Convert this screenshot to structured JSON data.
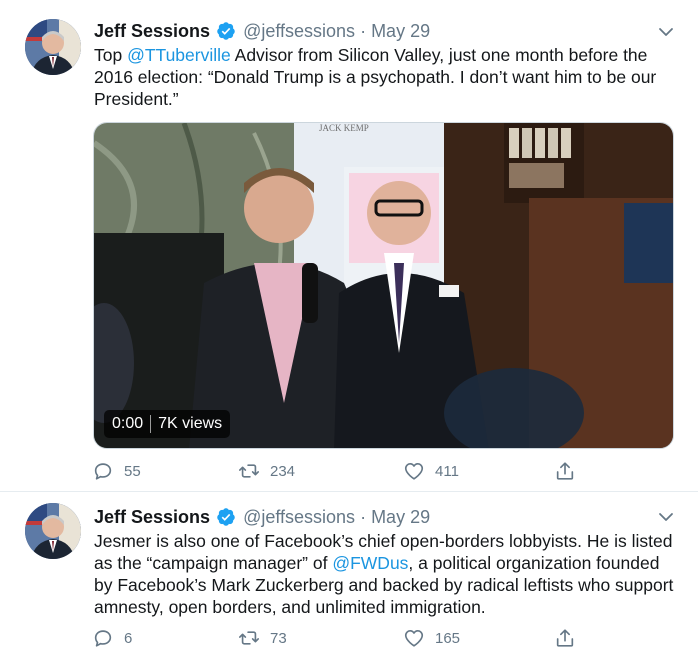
{
  "tweets": [
    {
      "display_name": "Jeff Sessions",
      "handle": "@jeffsessions",
      "separator": "·",
      "date": "May 29",
      "text_parts": {
        "before": "Top ",
        "mention": "@TTuberville",
        "after": " Advisor from Silicon Valley, just one month before the 2016 election: “Donald Trump is a psychopath. I don’t want him to be our President.”"
      },
      "video": {
        "time": "0:00",
        "views": "7K views",
        "backdrop_text": "JACK KEMP"
      },
      "counts": {
        "replies": "55",
        "retweets": "234",
        "likes": "411"
      }
    },
    {
      "display_name": "Jeff Sessions",
      "handle": "@jeffsessions",
      "separator": "·",
      "date": "May 29",
      "text_parts": {
        "before": "Jesmer is also one of Facebook’s chief open-borders lobbyists. He is listed as the “campaign manager” of ",
        "mention": "@FWDus",
        "after": ", a political organization founded by Facebook’s Mark Zuckerberg and backed by radical leftists who support amnesty, open borders, and unlimited immigration."
      },
      "counts": {
        "replies": "6",
        "retweets": "73",
        "likes": "165"
      }
    }
  ],
  "colors": {
    "link": "#1b95e0",
    "secondary_text": "#657786",
    "verified": "#1da1f2",
    "divider": "#e6ecf0"
  },
  "icons": [
    "verified-badge-icon",
    "caret-down-icon",
    "reply-icon",
    "retweet-icon",
    "like-icon",
    "share-icon"
  ]
}
